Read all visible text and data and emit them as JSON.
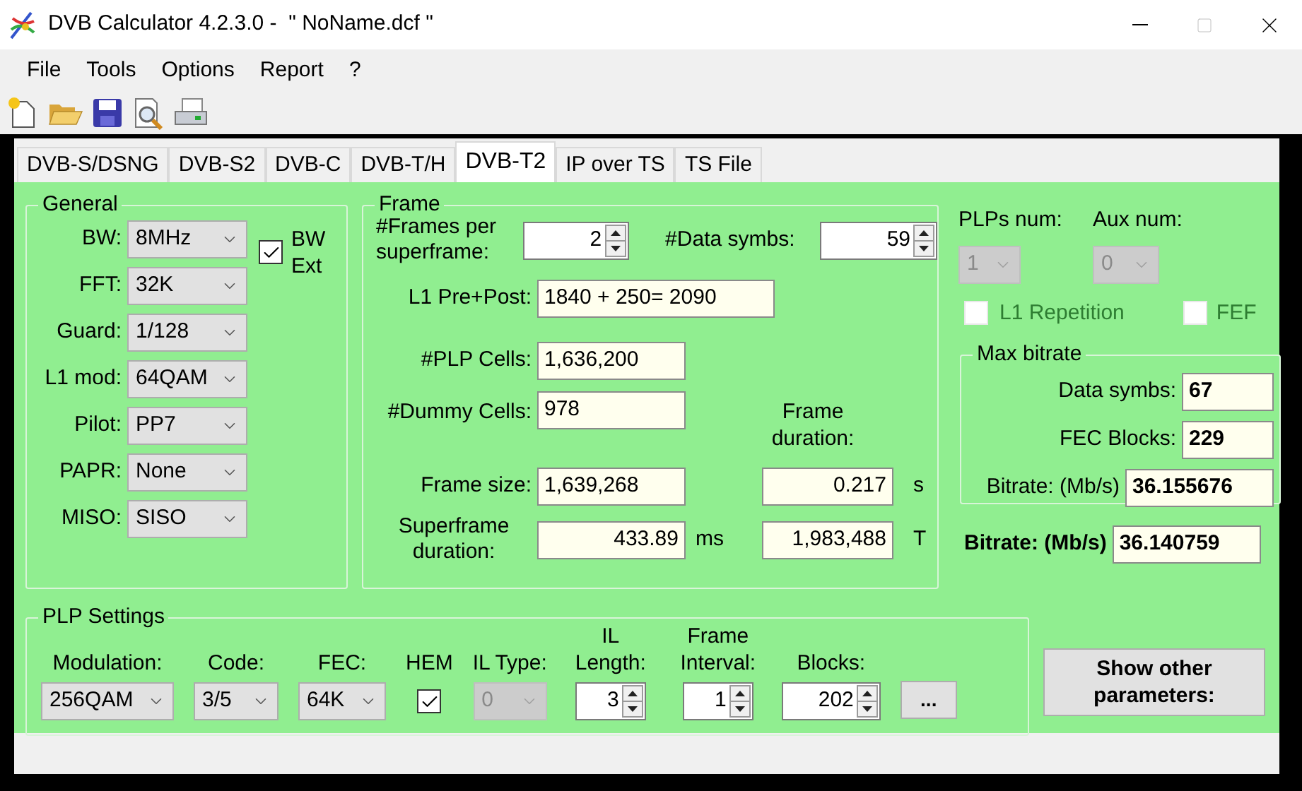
{
  "window": {
    "title": "DVB Calculator 4.2.3.0 -  \" NoName.dcf \""
  },
  "menu": [
    "File",
    "Tools",
    "Options",
    "Report",
    "?"
  ],
  "tabs": [
    {
      "label": "DVB-S/DSNG",
      "selected": false
    },
    {
      "label": "DVB-S2",
      "selected": false
    },
    {
      "label": "DVB-C",
      "selected": false
    },
    {
      "label": "DVB-T/H",
      "selected": false
    },
    {
      "label": "DVB-T2",
      "selected": true
    },
    {
      "label": "IP over TS",
      "selected": false
    },
    {
      "label": "TS File",
      "selected": false
    }
  ],
  "general": {
    "title": "General",
    "fields": [
      {
        "label": "BW:",
        "value": "8MHz"
      },
      {
        "label": "FFT:",
        "value": "32K"
      },
      {
        "label": "Guard:",
        "value": "1/128"
      },
      {
        "label": "L1 mod:",
        "value": "64QAM"
      },
      {
        "label": "Pilot:",
        "value": "PP7"
      },
      {
        "label": "PAPR:",
        "value": "None"
      },
      {
        "label": "MISO:",
        "value": "SISO"
      }
    ],
    "bw_ext": {
      "label": "BW Ext",
      "checked": true
    }
  },
  "frame": {
    "title": "Frame",
    "frames_per_superframe": {
      "label": "#Frames per superframe:",
      "value": "2"
    },
    "data_symbs": {
      "label": "#Data symbs:",
      "value": "59"
    },
    "l1_pre_post": {
      "label": "L1 Pre+Post:",
      "value": "1840 + 250= 2090"
    },
    "plp_cells": {
      "label": "#PLP Cells:",
      "value": "1,636,200"
    },
    "dummy_cells": {
      "label": "#Dummy Cells:",
      "value": "978"
    },
    "frame_duration_label": "Frame duration:",
    "frame_size": {
      "label": "Frame size:",
      "value": "1,639,268"
    },
    "frame_duration_s": {
      "value": "0.217",
      "unit": "s"
    },
    "superframe_duration": {
      "label": "Superframe duration:",
      "value": "433.89",
      "unit": "ms"
    },
    "frame_duration_t": {
      "value": "1,983,488",
      "unit": "T"
    }
  },
  "plps": {
    "plps_num": {
      "label": "PLPs num:",
      "value": "1",
      "disabled": true
    },
    "aux_num": {
      "label": "Aux num:",
      "value": "0",
      "disabled": true
    },
    "l1_repetition": {
      "label": "L1 Repetition",
      "checked": false
    },
    "fef": {
      "label": "FEF",
      "checked": false
    }
  },
  "max_bitrate": {
    "title": "Max bitrate",
    "rows": [
      {
        "label": "Data symbs:",
        "value": "67"
      },
      {
        "label": "FEC Blocks:",
        "value": "229"
      },
      {
        "label": "Bitrate: (Mb/s)",
        "value": "36.155676"
      }
    ]
  },
  "bitrate": {
    "label": "Bitrate: (Mb/s)",
    "value": "36.140759"
  },
  "plp_settings": {
    "title": "PLP Settings",
    "fields": [
      {
        "kind": "select",
        "label": "Modulation:",
        "value": "256QAM",
        "disabled": false
      },
      {
        "kind": "select",
        "label": "Code:",
        "value": "3/5",
        "disabled": false
      },
      {
        "kind": "select",
        "label": "FEC:",
        "value": "64K",
        "disabled": false
      },
      {
        "kind": "checkbox",
        "label": "HEM",
        "checked": true
      },
      {
        "kind": "select",
        "label": "IL Type:",
        "value": "0",
        "disabled": true
      },
      {
        "kind": "spinner",
        "label": "IL Length:",
        "value": "3"
      },
      {
        "kind": "spinner",
        "label": "Frame Interval:",
        "value": "1"
      },
      {
        "kind": "spinner",
        "label": "Blocks:",
        "value": "202"
      }
    ],
    "more_button": "..."
  },
  "show_other_button": "Show other parameters:"
}
